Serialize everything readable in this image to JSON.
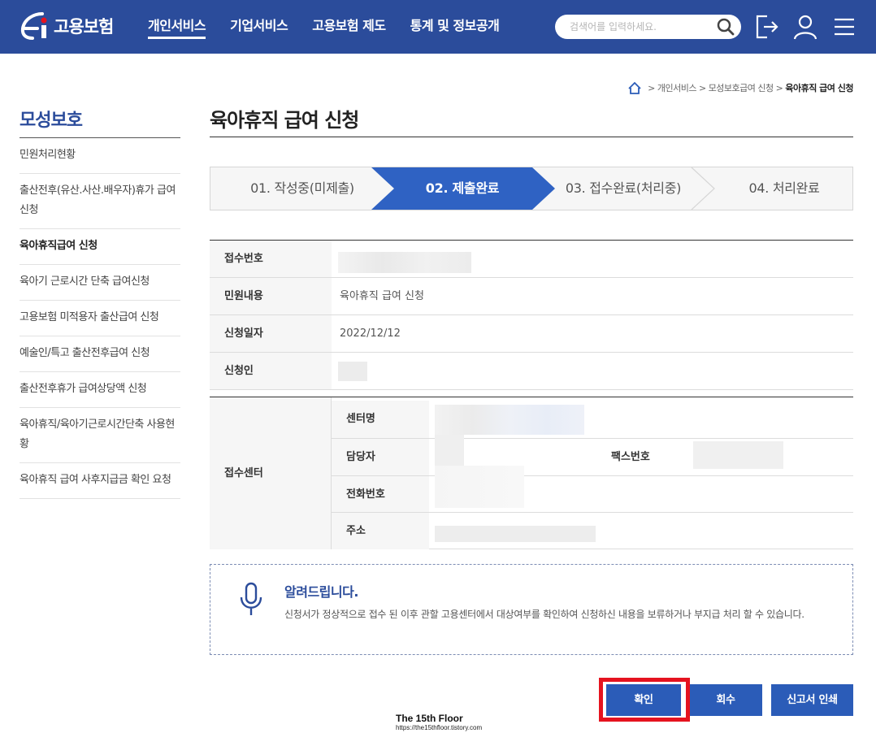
{
  "header": {
    "logo_text": "고용보험",
    "nav": [
      "개인서비스",
      "기업서비스",
      "고용보험 제도",
      "통계 및 정보공개"
    ],
    "search_placeholder": "검색어를 입력하세요."
  },
  "breadcrumb": {
    "items": [
      "개인서비스",
      "모성보호급여 신청"
    ],
    "current": "육아휴직 급여 신청"
  },
  "sidebar": {
    "title": "모성보호",
    "items": [
      {
        "label": "민원처리현황"
      },
      {
        "label": "출산전후(유산.사산.배우자)휴가 급여신청"
      },
      {
        "label": "육아휴직급여 신청"
      },
      {
        "label": "육아기 근로시간 단축 급여신청"
      },
      {
        "label": "고용보험 미적용자 출산급여 신청"
      },
      {
        "label": "예술인/특고 출산전후급여 신청"
      },
      {
        "label": "출산전후휴가 급여상당액 신청"
      },
      {
        "label": "육아휴직/육아기근로시간단축 사용현황"
      },
      {
        "label": "육아휴직 급여 사후지급금 확인 요청"
      }
    ]
  },
  "page_title": "육아휴직 급여 신청",
  "steps": [
    "01. 작성중(미제출)",
    "02. 제출완료",
    "03. 접수완료(처리중)",
    "04. 처리완료"
  ],
  "info": {
    "receipt_no_label": "접수번호",
    "content_label": "민원내용",
    "content_value": "육아휴직 급여 신청",
    "date_label": "신청일자",
    "date_value": "2022/12/12",
    "applicant_label": "신청인"
  },
  "center": {
    "label": "접수센터",
    "name_label": "센터명",
    "manager_label": "담당자",
    "fax_label": "팩스번호",
    "phone_label": "전화번호",
    "address_label": "주소"
  },
  "notice": {
    "title": "알려드립니다.",
    "text": "신청서가 정상적으로 접수 된 이후 관할 고용센터에서 대상여부를 확인하여 신청하신 내용을 보류하거나 부지급 처리 할 수 있습니다."
  },
  "buttons": {
    "confirm": "확인",
    "withdraw": "회수",
    "print": "신고서 인쇄"
  },
  "watermark": {
    "title": "The 15th Floor",
    "url": "https://the15thfloor.tistory.com"
  },
  "colors": {
    "brand": "#2b4c9b",
    "button": "#2b5cb8",
    "active_step": "#2f62c3",
    "highlight": "#e5131f"
  }
}
